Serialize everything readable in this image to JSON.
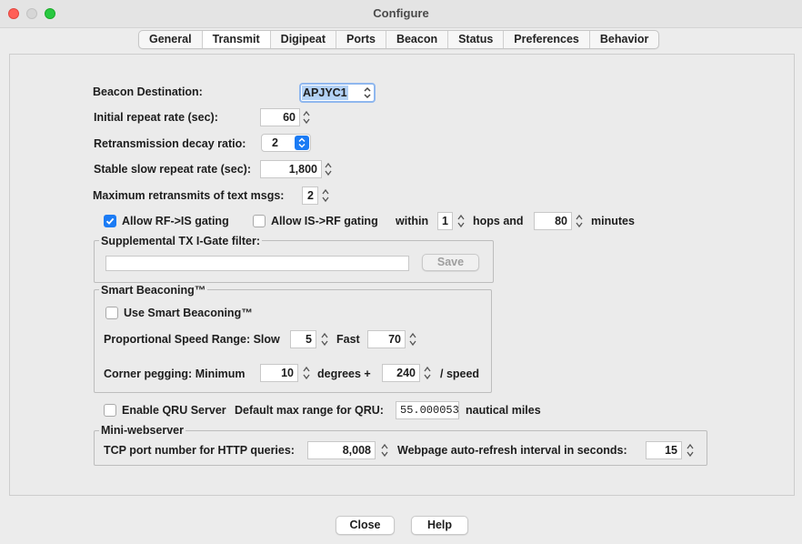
{
  "window": {
    "title": "Configure"
  },
  "tabs": [
    "General",
    "Transmit",
    "Digipeat",
    "Ports",
    "Beacon",
    "Status",
    "Preferences",
    "Behavior"
  ],
  "selected_tab": "Transmit",
  "transmit": {
    "beacon_destination": {
      "label": "Beacon Destination:",
      "value": "APJYC1"
    },
    "initial_repeat": {
      "label": "Initial repeat rate (sec):",
      "value": "60"
    },
    "decay_ratio": {
      "label": "Retransmission decay ratio:",
      "value": "2"
    },
    "stable_slow": {
      "label": "Stable slow repeat rate (sec):",
      "value": "1,800"
    },
    "max_retransmits": {
      "label": "Maximum retransmits of text msgs:",
      "value": "2"
    },
    "gating": {
      "rf_is_label": "Allow RF->IS gating",
      "rf_is_checked": true,
      "is_rf_label": "Allow IS->RF gating",
      "is_rf_checked": false,
      "within_label": "within",
      "hops_value": "1",
      "hops_label": "hops and",
      "minutes_value": "80",
      "minutes_label": "minutes"
    },
    "igate_filter": {
      "title": "Supplemental TX I-Gate filter:",
      "value": "",
      "save_label": "Save"
    },
    "smart_beaconing": {
      "title": "Smart Beaconing™",
      "use_label": "Use Smart Beaconing™",
      "use_checked": false,
      "speed_label": "Proportional Speed Range: Slow",
      "slow_value": "5",
      "fast_label": "Fast",
      "fast_value": "70",
      "corner_label": "Corner pegging: Minimum",
      "min_value": "10",
      "degrees_label": "degrees +",
      "speed_value": "240",
      "per_speed_label": "/ speed"
    },
    "qru": {
      "enable_label": "Enable QRU Server",
      "enable_checked": false,
      "range_label": "Default max range for QRU:",
      "range_value": "55.000053",
      "units_label": "nautical miles"
    },
    "webserver": {
      "title": "Mini-webserver",
      "port_label": "TCP port number for HTTP queries:",
      "port_value": "8,008",
      "refresh_label": "Webpage auto-refresh interval in seconds:",
      "refresh_value": "15"
    }
  },
  "footer": {
    "close_label": "Close",
    "help_label": "Help"
  },
  "colors": {
    "accent": "#1b7bf4",
    "selection": "#b3d1f5",
    "close_light": "#ff5f57",
    "min_light": "#d8d8d8",
    "zoom_light": "#28c840"
  }
}
